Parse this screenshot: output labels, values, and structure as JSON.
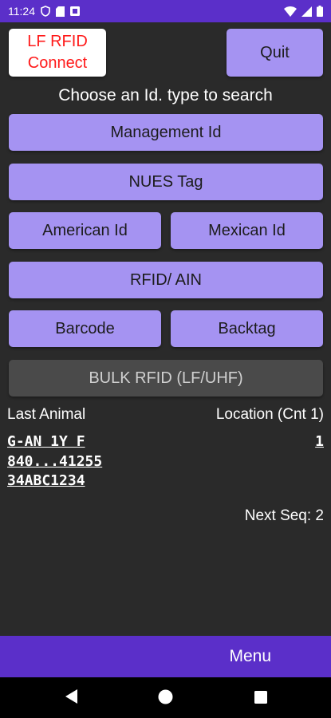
{
  "status_bar": {
    "time": "11:24",
    "icons": [
      "shield-icon",
      "sd-card-icon",
      "notification-icon",
      "wifi-icon",
      "signal-icon",
      "battery-icon"
    ]
  },
  "header": {
    "connect_line1": "LF RFID",
    "connect_line2": "Connect",
    "quit_label": "Quit"
  },
  "prompt": "Choose an Id. type to search",
  "id_buttons": {
    "management": "Management Id",
    "nues": "NUES Tag",
    "american": "American Id",
    "mexican": "Mexican Id",
    "rfid_ain": "RFID/ AIN",
    "barcode": "Barcode",
    "backtag": "Backtag",
    "bulk": "BULK RFID (LF/UHF)"
  },
  "last_animal": {
    "label": "Last Animal",
    "location_label": "Location (Cnt 1)",
    "line1": "G-AN 1Y F",
    "line2": "840...41255",
    "line3": "34ABC1234",
    "location_value": "1"
  },
  "next_seq": "Next Seq: 2",
  "menu_label": "Menu",
  "colors": {
    "accent": "#5b2fc9",
    "button": "#a593f2",
    "background": "#2a2a2a",
    "connect_text": "#ff1a1a"
  }
}
